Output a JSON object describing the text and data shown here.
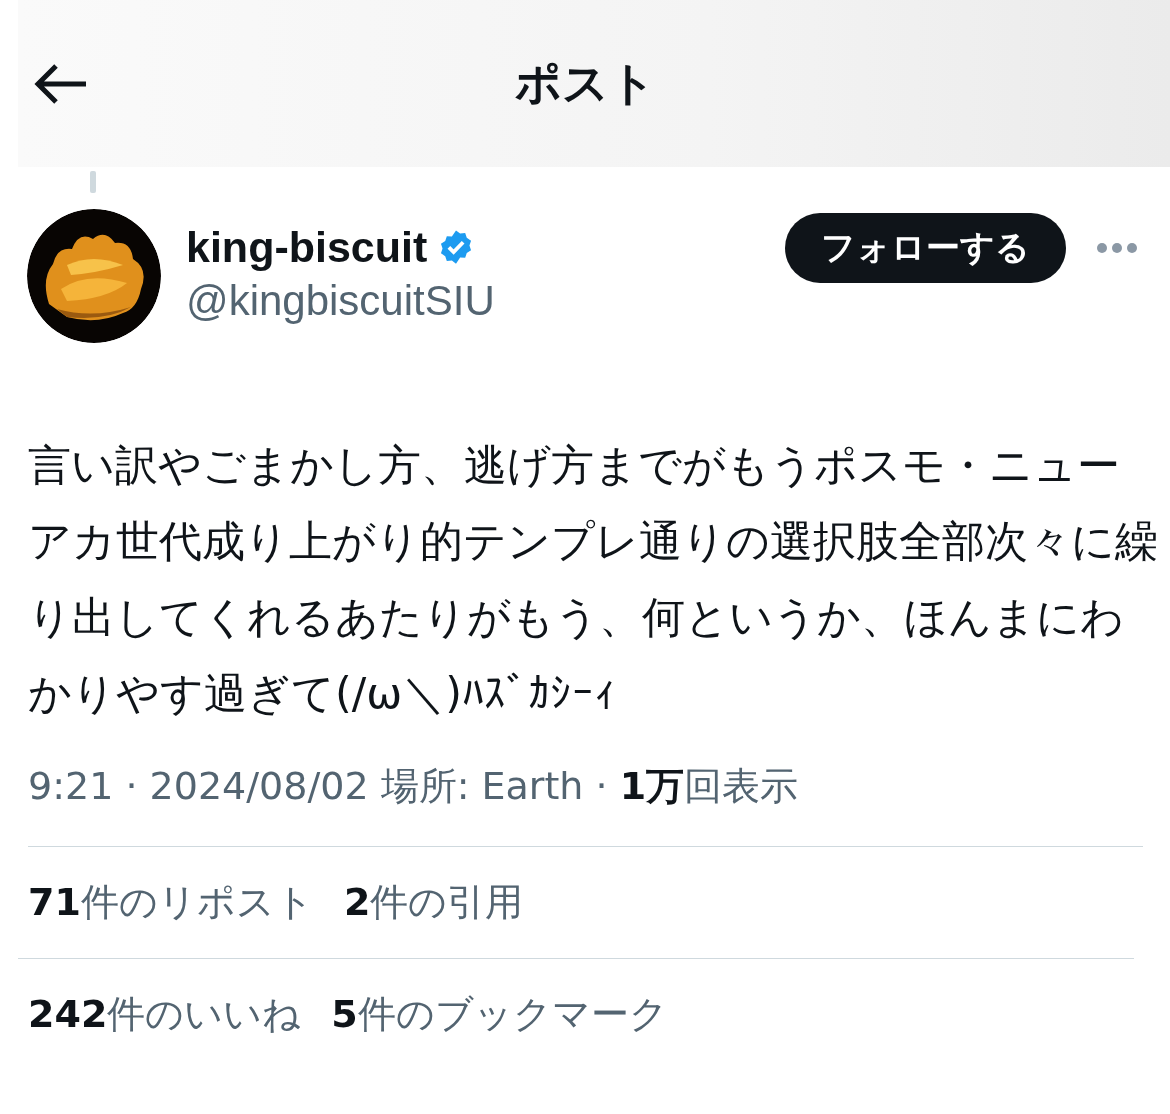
{
  "header": {
    "title": "ポスト"
  },
  "author": {
    "name": "king-biscuit",
    "verified": true,
    "handle": "@kingbiscuitSIU",
    "follow_button": "フォローする"
  },
  "post": {
    "text": "言い訳やごまかし方、逃げ方までがもうポスモ・ニューアカ世代成り上がり的テンプレ通りの選択肢全部次々に繰り出してくれるあたりがもう、何というか、ほんまにわかりやす過ぎて(/ω＼)ﾊｽﾞｶｼｰｨ",
    "meta": "9:21 · 2024/08/02 場所: Earth · **1万**回表示"
  },
  "stats": [
    [
      "**71**件のリポスト",
      "**2**件の引用"
    ],
    [
      "**242**件のいいね",
      "**5**件のブックマーク"
    ]
  ]
}
